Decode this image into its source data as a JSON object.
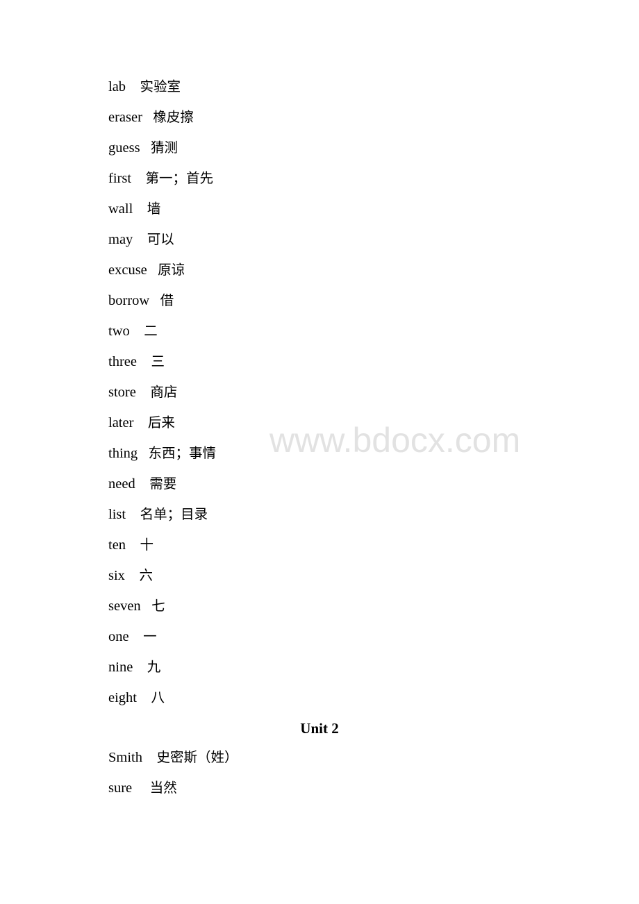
{
  "watermark": "www.bdocx.com",
  "unit1_entries": [
    {
      "word": "lab",
      "gap": "    ",
      "meaning": "实验室"
    },
    {
      "word": "eraser",
      "gap": "   ",
      "meaning": "橡皮擦"
    },
    {
      "word": "guess",
      "gap": "   ",
      "meaning": "猜测"
    },
    {
      "word": "first",
      "gap": "    ",
      "meaning": "第一；首先"
    },
    {
      "word": "wall",
      "gap": "    ",
      "meaning": "墙"
    },
    {
      "word": "may",
      "gap": "    ",
      "meaning": "可以"
    },
    {
      "word": "excuse",
      "gap": "   ",
      "meaning": "原谅"
    },
    {
      "word": "borrow",
      "gap": "   ",
      "meaning": "借"
    },
    {
      "word": "two",
      "gap": "    ",
      "meaning": "二"
    },
    {
      "word": "three",
      "gap": "    ",
      "meaning": "三"
    },
    {
      "word": "store",
      "gap": "    ",
      "meaning": "商店"
    },
    {
      "word": "later",
      "gap": "    ",
      "meaning": "后来"
    },
    {
      "word": "thing",
      "gap": "   ",
      "meaning": "东西；事情"
    },
    {
      "word": "need",
      "gap": "    ",
      "meaning": "需要"
    },
    {
      "word": "list",
      "gap": "    ",
      "meaning": "名单；目录"
    },
    {
      "word": "ten",
      "gap": "    ",
      "meaning": "十"
    },
    {
      "word": "six",
      "gap": "    ",
      "meaning": "六"
    },
    {
      "word": "seven",
      "gap": "   ",
      "meaning": "七"
    },
    {
      "word": "one",
      "gap": "    ",
      "meaning": "一"
    },
    {
      "word": "nine",
      "gap": "    ",
      "meaning": "九"
    },
    {
      "word": "eight",
      "gap": "    ",
      "meaning": "八"
    }
  ],
  "unit2": {
    "heading": "Unit 2",
    "entries": [
      {
        "word": "Smith",
        "gap": "    ",
        "meaning": "史密斯（姓）"
      },
      {
        "word": "sure",
        "gap": "     ",
        "meaning": "当然"
      }
    ]
  }
}
